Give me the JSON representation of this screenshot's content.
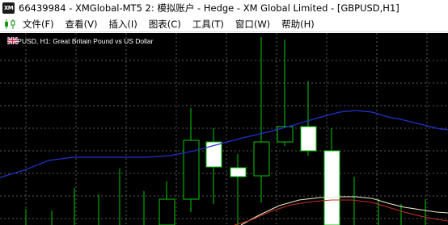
{
  "window": {
    "title": "66439984 - XMGlobal-MT5 2: 模拟账户 - Hedge - XM Global Limited - [GBPUSD,H1]",
    "app_icon_text": "XM"
  },
  "menu": {
    "items": [
      "文件(F)",
      "查看(V)",
      "插入(I)",
      "图表(C)",
      "工具(T)",
      "窗口(W)",
      "帮助(H)"
    ]
  },
  "chart": {
    "label": "GBPUSD, H1:  Great Britain Pound vs US Dollar",
    "colors": {
      "background": "#000000",
      "grid": "#5a5a5a",
      "bull_candle": "#00c800",
      "bear_candle_fill": "#ffffff",
      "ma_blue": "#2233cc",
      "ma_white": "#e8e8c8",
      "ma_red": "#c0301c"
    }
  }
}
